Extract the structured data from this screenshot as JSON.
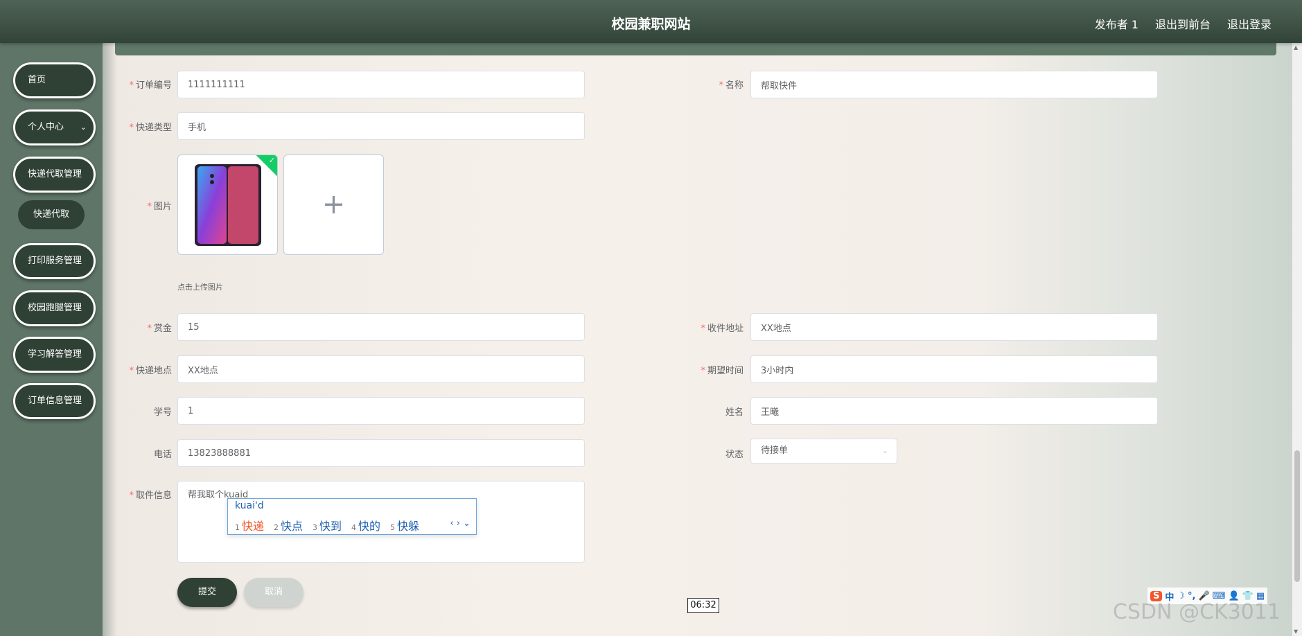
{
  "header": {
    "site_title": "校园兼职网站",
    "links": [
      "发布者 1",
      "退出到前台",
      "退出登录"
    ]
  },
  "sidebar": {
    "items": [
      {
        "label": "首页"
      },
      {
        "label": "个人中心",
        "chevron": "chevron-down-icon"
      },
      {
        "label": "快递代取管理"
      },
      {
        "label": "打印服务管理"
      },
      {
        "label": "校园跑腿管理"
      },
      {
        "label": "学习解答管理"
      },
      {
        "label": "订单信息管理"
      }
    ],
    "active_sub_item": "快递代取"
  },
  "form": {
    "order_no": {
      "label": "订单编号",
      "required": true,
      "value": "1111111111"
    },
    "name": {
      "label": "名称",
      "required": true,
      "value": "帮取快件"
    },
    "express_type": {
      "label": "快递类型",
      "required": true,
      "value": "手机"
    },
    "image": {
      "label": "图片",
      "required": true,
      "hint": "点击上传图片"
    },
    "reward": {
      "label": "赏金",
      "required": true,
      "value": "15"
    },
    "receive_address": {
      "label": "收件地址",
      "required": true,
      "value": "XX地点"
    },
    "express_location": {
      "label": "快递地点",
      "required": true,
      "value": "XX地点"
    },
    "expected_time": {
      "label": "期望时间",
      "required": true,
      "value": "3小时内"
    },
    "student_no": {
      "label": "学号",
      "required": false,
      "value": "1"
    },
    "real_name": {
      "label": "姓名",
      "required": false,
      "value": "王曦"
    },
    "phone": {
      "label": "电话",
      "required": false,
      "value": "13823888881"
    },
    "status": {
      "label": "状态",
      "required": false,
      "value": "待接单"
    },
    "pickup_info": {
      "label": "取件信息",
      "required": true,
      "value": "帮我取个kuaid"
    },
    "submit_label": "提交",
    "cancel_label": "取消"
  },
  "ime": {
    "composition": "kuai'd",
    "candidates": [
      {
        "n": "1",
        "text": "快递"
      },
      {
        "n": "2",
        "text": "快点"
      },
      {
        "n": "3",
        "text": "快到"
      },
      {
        "n": "4",
        "text": "快的"
      },
      {
        "n": "5",
        "text": "快躲"
      }
    ],
    "toolbar": [
      "S",
      "中",
      "☽",
      "°,",
      "🎤",
      "⌨",
      "👤",
      "👕",
      "▦"
    ]
  },
  "overlay": {
    "time": "06:32",
    "watermark": "CSDN @CK3011"
  }
}
